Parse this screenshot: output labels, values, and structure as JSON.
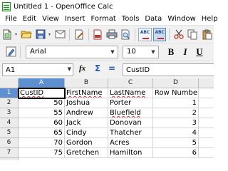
{
  "window": {
    "title": "Untitled 1 - OpenOffice Calc"
  },
  "menu": [
    "File",
    "Edit",
    "View",
    "Insert",
    "Format",
    "Tools",
    "Data",
    "Window",
    "Help"
  ],
  "toolbar1": {
    "icons": [
      "new-document-icon",
      "open-folder-icon",
      "save-icon",
      "email-icon",
      "edit-file-icon",
      "export-pdf-icon",
      "print-icon",
      "print-preview-icon",
      "spellcheck-icon",
      "autospellcheck-icon",
      "cut-icon",
      "copy-icon",
      "paste-icon"
    ],
    "spellcheck_label": "ABC"
  },
  "toolbar2": {
    "font_name": "Arial",
    "font_size": "10",
    "bold": "B",
    "italic": "I",
    "underline": "U"
  },
  "formula_bar": {
    "name_box": "A1",
    "function_symbol": "fx",
    "sum_symbol": "Σ",
    "equals_symbol": "=",
    "content": "CustID"
  },
  "sheet": {
    "columns": [
      "A",
      "B",
      "C",
      "D"
    ],
    "selected_column": "A",
    "selected_row": 1,
    "rows": [
      {
        "num": "1",
        "cells": [
          "CustID",
          "FirstName",
          "LastName",
          "Row Number"
        ]
      },
      {
        "num": "2",
        "cells": [
          "50",
          "Joshua",
          "Porter",
          "1"
        ]
      },
      {
        "num": "3",
        "cells": [
          "55",
          "Andrew",
          "Bluefield",
          "2"
        ]
      },
      {
        "num": "4",
        "cells": [
          "60",
          "Jack",
          "Donovan",
          "3"
        ]
      },
      {
        "num": "5",
        "cells": [
          "65",
          "Cindy",
          "Thatcher",
          "4"
        ]
      },
      {
        "num": "6",
        "cells": [
          "70",
          "Gordon",
          "Acres",
          "5"
        ]
      },
      {
        "num": "7",
        "cells": [
          "75",
          "Gretchen",
          "Hamilton",
          "6"
        ]
      }
    ]
  },
  "colors": {
    "selection_header": "#5e8fd0",
    "toolbar_bg": "#f1f1f1",
    "spell_underline": "#d03030"
  }
}
